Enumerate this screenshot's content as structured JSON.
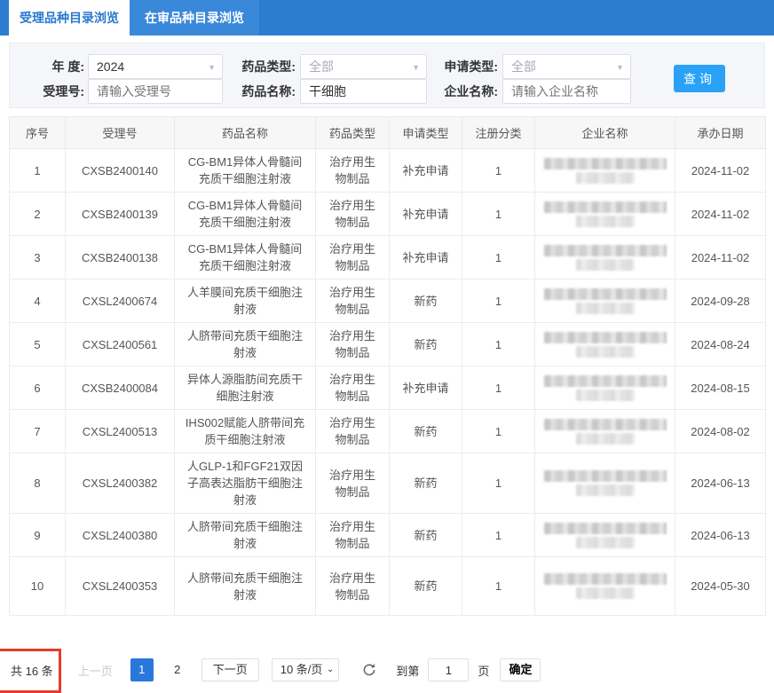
{
  "tabs": [
    {
      "label": "受理品种目录浏览",
      "active": true
    },
    {
      "label": "在审品种目录浏览",
      "active": false
    }
  ],
  "search": {
    "year_label": "年 度:",
    "year_value": "2024",
    "drug_type_label": "药品类型:",
    "drug_type_value": "全部",
    "apply_type_label": "申请类型:",
    "apply_type_value": "全部",
    "acceptance_no_label": "受理号:",
    "acceptance_no_placeholder": "请输入受理号",
    "drug_name_label": "药品名称:",
    "drug_name_value": "干细胞",
    "company_label": "企业名称:",
    "company_placeholder": "请输入企业名称",
    "query_button": "查询"
  },
  "table": {
    "headers": [
      "序号",
      "受理号",
      "药品名称",
      "药品类型",
      "申请类型",
      "注册分类",
      "企业名称",
      "承办日期"
    ],
    "rows": [
      {
        "no": "1",
        "acceptance_no": "CXSB2400140",
        "drug_name": "CG-BM1异体人骨髓间充质干细胞注射液",
        "drug_type": "治疗用生物制品",
        "apply_type": "补充申请",
        "reg_class": "1",
        "company_censored": true,
        "date": "2024-11-02"
      },
      {
        "no": "2",
        "acceptance_no": "CXSB2400139",
        "drug_name": "CG-BM1异体人骨髓间充质干细胞注射液",
        "drug_type": "治疗用生物制品",
        "apply_type": "补充申请",
        "reg_class": "1",
        "company_censored": true,
        "date": "2024-11-02"
      },
      {
        "no": "3",
        "acceptance_no": "CXSB2400138",
        "drug_name": "CG-BM1异体人骨髓间充质干细胞注射液",
        "drug_type": "治疗用生物制品",
        "apply_type": "补充申请",
        "reg_class": "1",
        "company_censored": true,
        "date": "2024-11-02"
      },
      {
        "no": "4",
        "acceptance_no": "CXSL2400674",
        "drug_name": "人羊膜间充质干细胞注射液",
        "drug_type": "治疗用生物制品",
        "apply_type": "新药",
        "reg_class": "1",
        "company_censored": true,
        "date": "2024-09-28"
      },
      {
        "no": "5",
        "acceptance_no": "CXSL2400561",
        "drug_name": "人脐带间充质干细胞注射液",
        "drug_type": "治疗用生物制品",
        "apply_type": "新药",
        "reg_class": "1",
        "company_censored": true,
        "date": "2024-08-24"
      },
      {
        "no": "6",
        "acceptance_no": "CXSB2400084",
        "drug_name": "异体人源脂肪间充质干细胞注射液",
        "drug_type": "治疗用生物制品",
        "apply_type": "补充申请",
        "reg_class": "1",
        "company_censored": true,
        "date": "2024-08-15"
      },
      {
        "no": "7",
        "acceptance_no": "CXSL2400513",
        "drug_name": "IHS002赋能人脐带间充质干细胞注射液",
        "drug_type": "治疗用生物制品",
        "apply_type": "新药",
        "reg_class": "1",
        "company_censored": true,
        "date": "2024-08-02"
      },
      {
        "no": "8",
        "acceptance_no": "CXSL2400382",
        "drug_name": "人GLP-1和FGF21双因子高表达脂肪干细胞注射液",
        "drug_type": "治疗用生物制品",
        "apply_type": "新药",
        "reg_class": "1",
        "company_censored": true,
        "date": "2024-06-13"
      },
      {
        "no": "9",
        "acceptance_no": "CXSL2400380",
        "drug_name": "人脐带间充质干细胞注射液",
        "drug_type": "治疗用生物制品",
        "apply_type": "新药",
        "reg_class": "1",
        "company_censored": true,
        "date": "2024-06-13"
      },
      {
        "no": "10",
        "acceptance_no": "CXSL2400353",
        "drug_name": "人脐带间充质干细胞注射液",
        "drug_type": "治疗用生物制品",
        "apply_type": "新药",
        "reg_class": "1",
        "company_censored": true,
        "date": "2024-05-30"
      }
    ]
  },
  "pagination": {
    "total_label": "共 16 条",
    "prev_label": "上一页",
    "pages": [
      "1",
      "2"
    ],
    "active_page": "1",
    "next_label": "下一页",
    "page_size_label": "10 条/页",
    "goto_label": "到第",
    "goto_value": "1",
    "goto_unit": "页",
    "confirm_label": "确定"
  },
  "colors": {
    "tabbar_blue": "#2c7dd2",
    "inactive_tab_blue": "#3a88da",
    "active_tab_text": "#2878d0",
    "query_button_blue": "#29a1f7",
    "active_page_blue": "#2878dc",
    "annotation_red": "#e43d2c"
  }
}
